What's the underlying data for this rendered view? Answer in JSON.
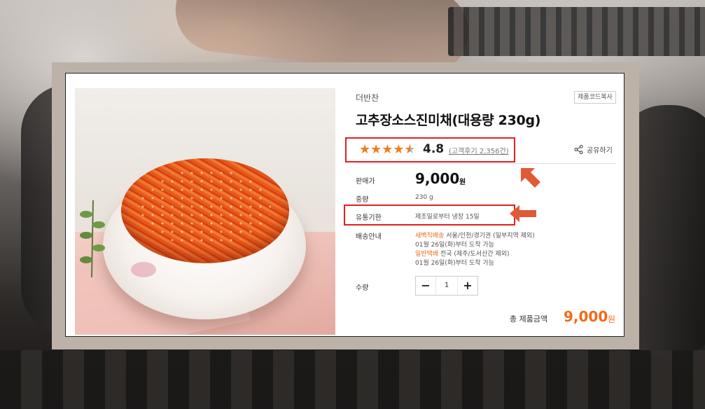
{
  "product": {
    "brand": "더반찬",
    "copy_code_button": "제품코드복사",
    "title": "고추장소스진미채(대용량 230g)",
    "rating": {
      "stars": "★★★★",
      "half_star": "★",
      "score": "4.8",
      "reviews": "(고객후기 2,356건)",
      "value": 4.5
    },
    "share_label": "공유하기",
    "price": {
      "label": "판매가",
      "amount": "9,000",
      "unit": "원"
    },
    "weight": {
      "label": "중량",
      "value": "230 g"
    },
    "expiry": {
      "label": "유통기한",
      "value": "제조일로부터 냉장 15일"
    },
    "shipping": {
      "label": "배송안내",
      "dawn_name": "새벽직배송",
      "dawn_area": " 서울/인천/경기권 (일부지역 제외)",
      "dawn_date": "01월 26일(화)부터 도착 가능",
      "parcel_name": "일반택배",
      "parcel_area": " 전국 (제주/도서산간 제외)",
      "parcel_date": "01월 26일(화)부터 도착 가능"
    },
    "quantity": {
      "label": "수량",
      "minus": "−",
      "value": "1",
      "plus": "+"
    },
    "total": {
      "label": "총 제품금액",
      "amount": "9,000",
      "unit": "원"
    }
  },
  "colors": {
    "accent": "#f26a1b",
    "highlight_box": "#e02020",
    "arrow": "#e05a35"
  },
  "icons": {
    "share": "share-icon",
    "star": "star-icon",
    "arrow": "arrow-icon"
  }
}
